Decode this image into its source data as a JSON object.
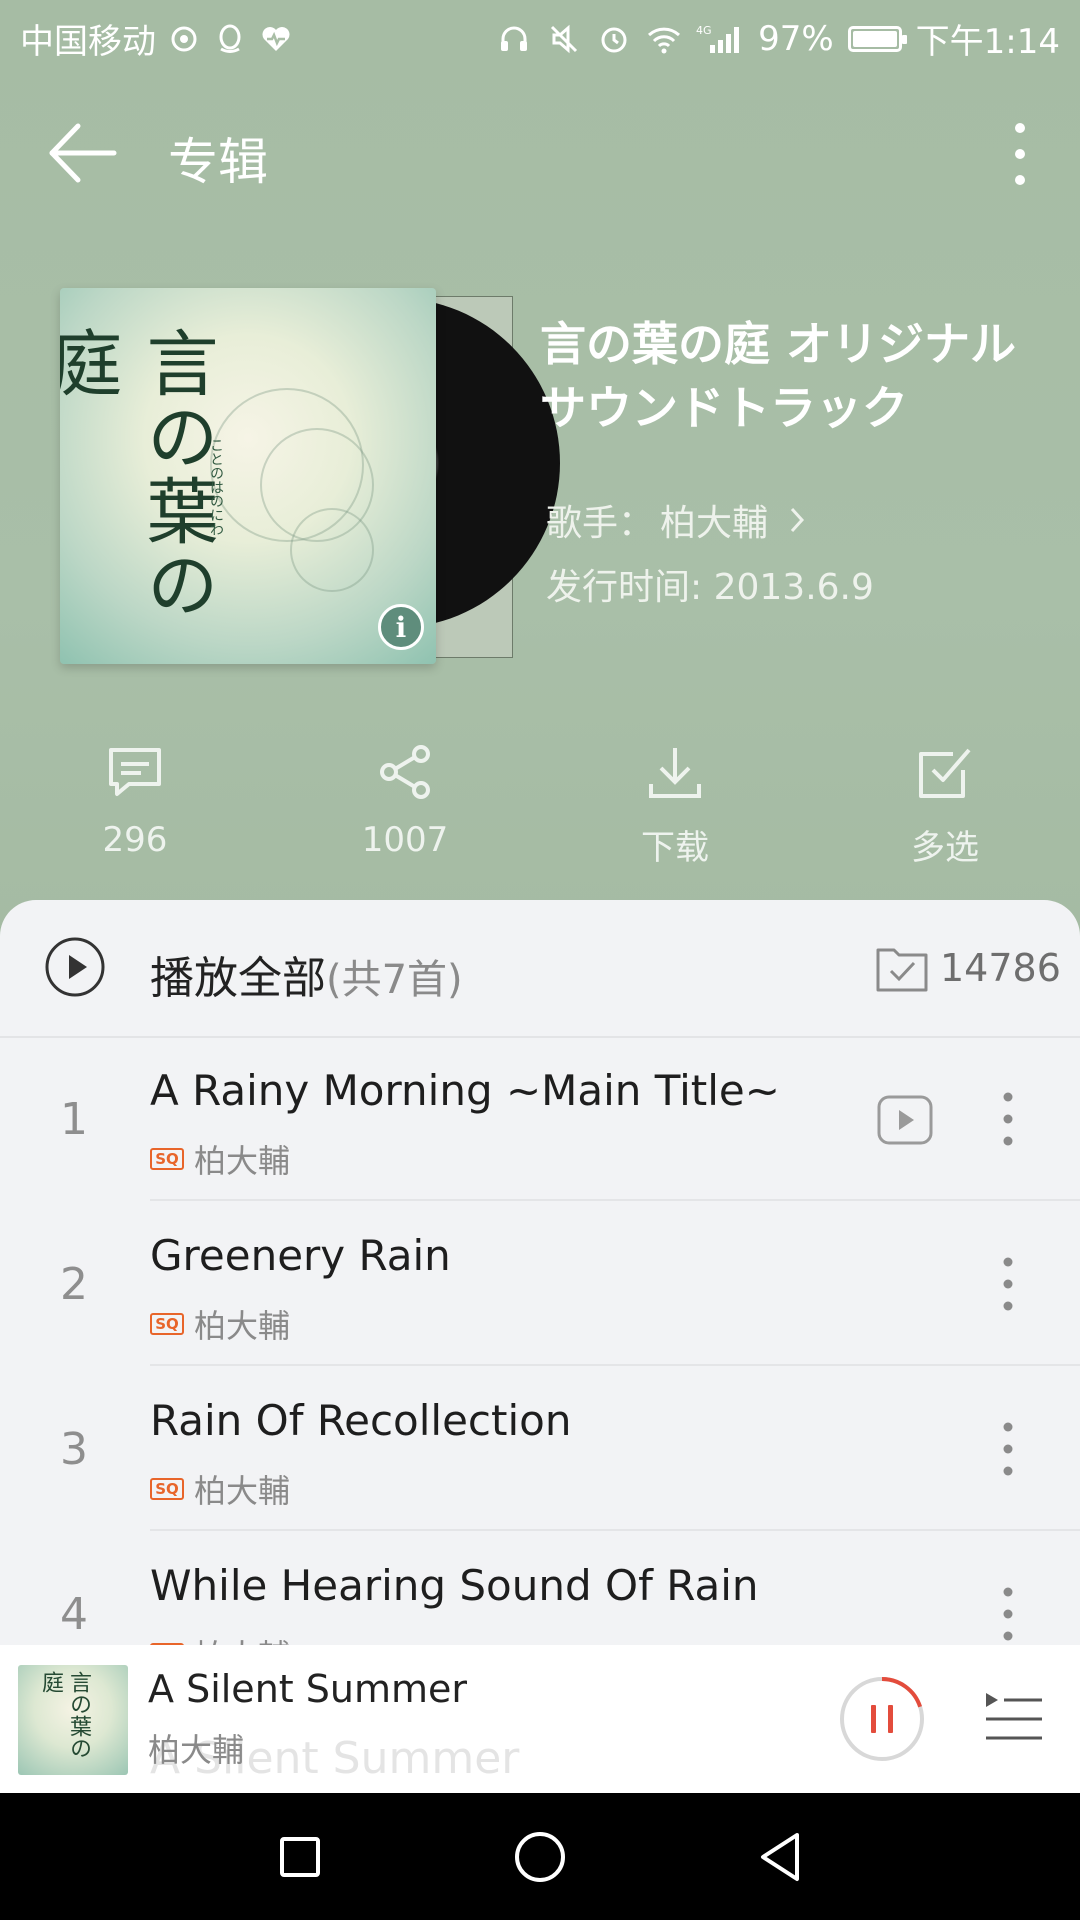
{
  "status_bar": {
    "carrier": "中国移动",
    "network": "4G",
    "battery": "97%",
    "time": "下午1:14"
  },
  "title_bar": {
    "title": "专辑"
  },
  "album": {
    "cover_text": "言の葉の庭",
    "cover_subtext": "ことのはのにわ",
    "name": "言の葉の庭 オリジナル サウンドトラック",
    "artist_label": "歌手：",
    "artist": "柏大輔",
    "release_label": "发行时间: ",
    "release_date": "2013.6.9"
  },
  "actions": [
    {
      "icon": "comment-icon",
      "label": "296"
    },
    {
      "icon": "share-icon",
      "label": "1007"
    },
    {
      "icon": "download-icon",
      "label": "下载"
    },
    {
      "icon": "multi-select-icon",
      "label": "多选"
    }
  ],
  "list": {
    "play_all_label": "播放全部",
    "play_all_count": "(共7首)",
    "collect_count": "14786",
    "quality_badge": "SQ",
    "tracks": [
      {
        "num": "1",
        "title": "A Rainy Morning ~Main Title~",
        "artist": "柏大輔"
      },
      {
        "num": "2",
        "title": "Greenery Rain",
        "artist": "柏大輔"
      },
      {
        "num": "3",
        "title": "Rain Of Recollection",
        "artist": "柏大輔"
      },
      {
        "num": "4",
        "title": "While Hearing Sound Of Rain",
        "artist": "柏大輔"
      }
    ]
  },
  "mini_player": {
    "title": "A Silent Summer",
    "artist": "柏大輔",
    "ghost_title": "A Silent Summer",
    "progress": 0.2
  },
  "colors": {
    "header_bg": "#a9bea6",
    "accent_red": "#e34c3c",
    "sq_orange": "#e8652a"
  }
}
